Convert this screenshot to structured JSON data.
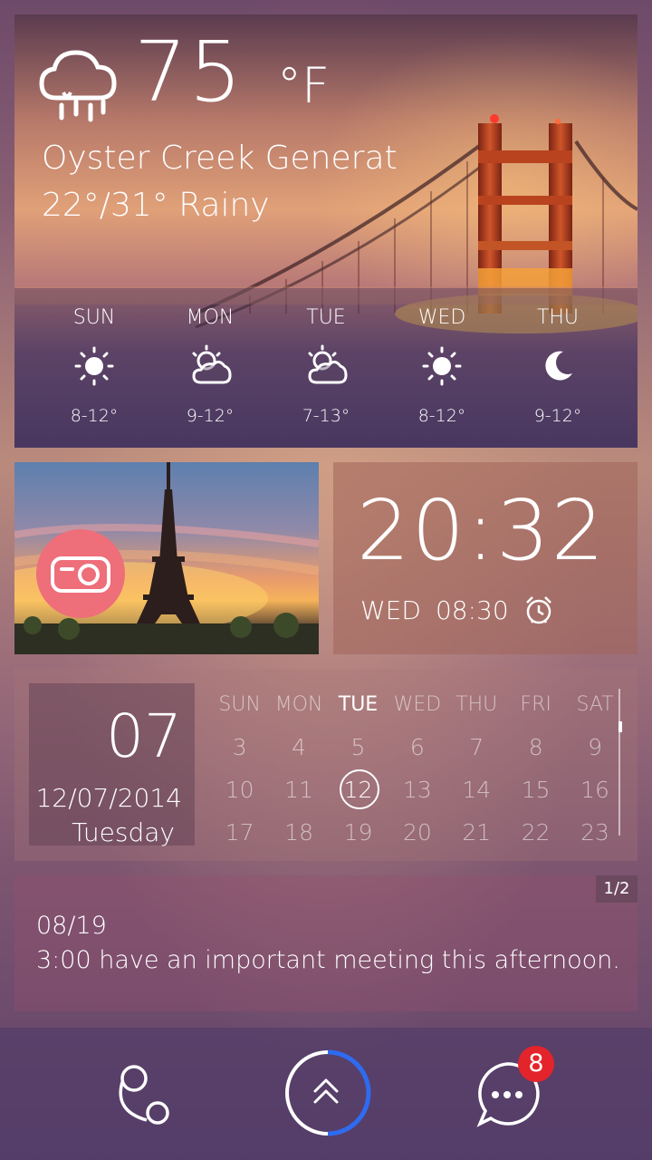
{
  "weather": {
    "current_icon": "rain-cloud-icon",
    "temperature": "75",
    "unit": "°F",
    "location": "Oyster Creek Generat",
    "summary": "22°/31°  Rainy",
    "forecast": [
      {
        "day": "SUN",
        "icon": "sun-icon",
        "range": "8-12°"
      },
      {
        "day": "MON",
        "icon": "partly-cloudy-icon",
        "range": "9-12°"
      },
      {
        "day": "TUE",
        "icon": "partly-cloudy-icon",
        "range": "7-13°"
      },
      {
        "day": "WED",
        "icon": "sun-icon",
        "range": "8-12°"
      },
      {
        "day": "THU",
        "icon": "moon-icon",
        "range": "9-12°"
      }
    ]
  },
  "photo": {
    "camera_icon": "camera-icon"
  },
  "clock": {
    "time": "20:32",
    "alarm_day": "WED",
    "alarm_time": "08:30",
    "alarm_icon": "alarm-clock-icon"
  },
  "calendar": {
    "day_number": "07",
    "full_date": "12/07/2014",
    "weekday": "Tuesday",
    "headers": [
      "SUN",
      "MON",
      "TUE",
      "WED",
      "THU",
      "FRI",
      "SAT"
    ],
    "highlight_header": "TUE",
    "rows": [
      [
        "3",
        "4",
        "5",
        "6",
        "7",
        "8",
        "9"
      ],
      [
        "10",
        "11",
        "12",
        "13",
        "14",
        "15",
        "16"
      ],
      [
        "17",
        "18",
        "19",
        "20",
        "21",
        "22",
        "23"
      ]
    ],
    "selected_day": "12"
  },
  "note": {
    "page": "1/2",
    "date": "08/19",
    "text": "3:00 have an important meeting this afternoon."
  },
  "dock": {
    "left_icon": "circles-icon",
    "center_icon": "double-chevron-up-icon",
    "right_icon": "message-dots-icon",
    "badge_count": "8",
    "progress_color": "#2f6bf0"
  }
}
